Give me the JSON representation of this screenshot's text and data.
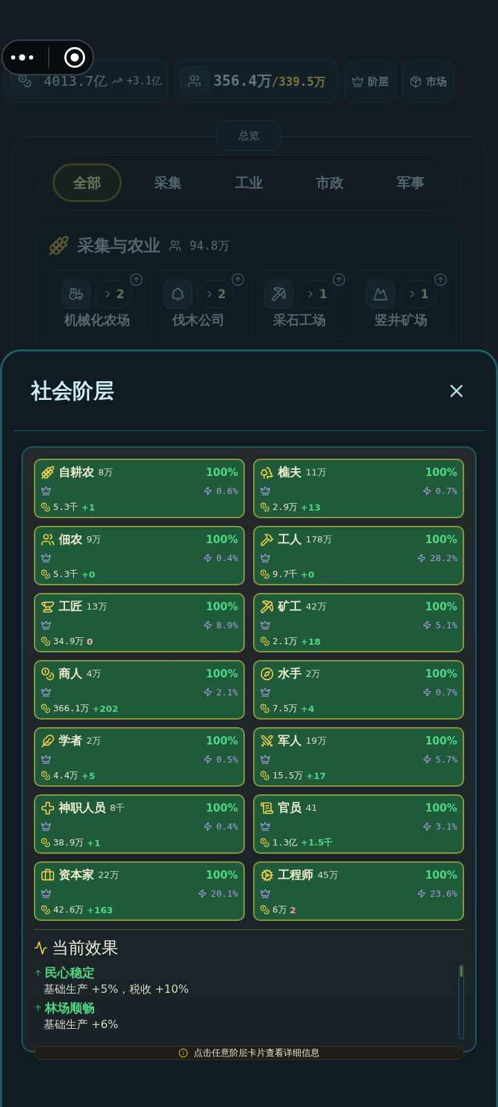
{
  "top_bar": {
    "treasury": "4013.7亿",
    "treasury_change": "+3.1亿",
    "population": "356.4万",
    "population_cap": "/339.5万",
    "buttons": [
      "阶层",
      "市场"
    ]
  },
  "overview": {
    "label": "总览",
    "tabs": [
      {
        "label": "全部",
        "selected": true
      },
      {
        "label": "采集",
        "selected": false
      },
      {
        "label": "工业",
        "selected": false
      },
      {
        "label": "市政",
        "selected": false
      },
      {
        "label": "军事",
        "selected": false
      }
    ],
    "section": {
      "title": "采集与农业",
      "population": "94.8万",
      "buildings": [
        {
          "name": "机械化农场",
          "count": "2"
        },
        {
          "name": "伐木公司",
          "count": "2"
        },
        {
          "name": "采石工场",
          "count": "1"
        },
        {
          "name": "竖井矿场",
          "count": "1"
        }
      ]
    }
  },
  "dialog": {
    "title": "社会阶层",
    "strata": [
      {
        "name": "自耕农",
        "population": "8万",
        "approval": "100%",
        "influence": "0.6%",
        "wealth": "5.3千",
        "change": "+1",
        "color": "#4fd882"
      },
      {
        "name": "樵夫",
        "population": "11万",
        "approval": "100%",
        "influence": "0.7%",
        "wealth": "2.9万",
        "change": "+13",
        "color": "#4fd882"
      },
      {
        "name": "佃农",
        "population": "9万",
        "approval": "100%",
        "influence": "0.4%",
        "wealth": "5.3千",
        "change": "+0",
        "color": "#4fd882"
      },
      {
        "name": "工人",
        "population": "178万",
        "approval": "100%",
        "influence": "28.2%",
        "wealth": "9.7千",
        "change": "+0",
        "color": "#4fd882"
      },
      {
        "name": "工匠",
        "population": "13万",
        "approval": "100%",
        "influence": "8.9%",
        "wealth": "34.9万",
        "change": "0",
        "color": "#e8b9a0"
      },
      {
        "name": "矿工",
        "population": "42万",
        "approval": "100%",
        "influence": "5.1%",
        "wealth": "2.1万",
        "change": "+18",
        "color": "#4fd882"
      },
      {
        "name": "商人",
        "population": "4万",
        "approval": "100%",
        "influence": "2.1%",
        "wealth": "366.1万",
        "change": "+202",
        "color": "#4fd882"
      },
      {
        "name": "水手",
        "population": "2万",
        "approval": "100%",
        "influence": "0.7%",
        "wealth": "7.5万",
        "change": "+4",
        "color": "#4fd882"
      },
      {
        "name": "学者",
        "population": "2万",
        "approval": "100%",
        "influence": "0.5%",
        "wealth": "4.4万",
        "change": "+5",
        "color": "#4fd882"
      },
      {
        "name": "军人",
        "population": "19万",
        "approval": "100%",
        "influence": "5.7%",
        "wealth": "15.5万",
        "change": "+17",
        "color": "#4fd882"
      },
      {
        "name": "神职人员",
        "population": "8千",
        "approval": "100%",
        "influence": "0.4%",
        "wealth": "38.9万",
        "change": "+1",
        "color": "#4fd882"
      },
      {
        "name": "官员",
        "population": "41",
        "approval": "100%",
        "influence": "3.1%",
        "wealth": "1.3亿",
        "change": "+1.5千",
        "color": "#4fd882"
      },
      {
        "name": "资本家",
        "population": "22万",
        "approval": "100%",
        "influence": "20.1%",
        "wealth": "42.6万",
        "change": "+163",
        "color": "#4fd882"
      },
      {
        "name": "工程师",
        "population": "45万",
        "approval": "100%",
        "influence": "23.6%",
        "wealth": "6万",
        "change": "2",
        "color": "#f0a0a8"
      }
    ],
    "effects": {
      "title": "当前效果",
      "items": [
        {
          "name": "民心稳定",
          "detail": "基础生产 +5%，税收 +10%"
        },
        {
          "name": "林场顺畅",
          "detail": "基础生产 +6%"
        }
      ]
    },
    "hint": "点击任意阶层卡片查看详细信息"
  }
}
